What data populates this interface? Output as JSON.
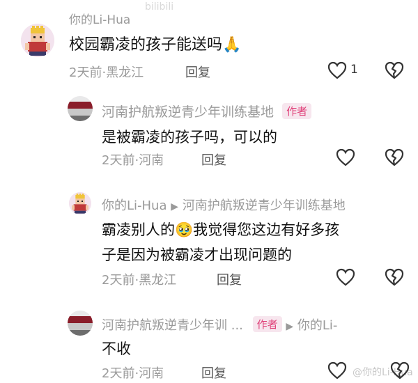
{
  "colors": {
    "accent": "#e0427a",
    "badge_bg": "#f7e6ee",
    "meta": "#9a9a9a",
    "text": "#111111"
  },
  "watermark": {
    "top": "bilibili",
    "bottom": "@你的Li-Hua"
  },
  "comments": [
    {
      "user": "你的Li-Hua",
      "text": "校园霸凌的孩子能送吗🙏",
      "time": "2天前",
      "location": "黑龙江",
      "reply": "回复",
      "likes": "1",
      "avatar_icon": "pixel-king-avatar-icon"
    },
    {
      "user": "河南护航叛逆青少年训练基地",
      "badge": "作者",
      "text": "是被霸凌的孩子吗，可以的",
      "time": "2天前",
      "location": "河南",
      "reply": "回复",
      "avatar_icon": "building-avatar-icon"
    },
    {
      "user": "你的Li-Hua",
      "reply_to": "河南护航叛逆青少年训练基地",
      "text_line1": "霸凌别人的🥹我觉得您这边有好多孩",
      "text_line2": "子是因为被霸凌才出现问题的",
      "time": "2天前",
      "location": "黑龙江",
      "reply": "回复",
      "avatar_icon": "pixel-king-avatar-icon"
    },
    {
      "user": "河南护航叛逆青少年训 ...",
      "badge": "作者",
      "reply_to": "你的Li-",
      "text": "不收",
      "time": "2天前",
      "location": "河南",
      "reply": "回复",
      "avatar_icon": "building-avatar-icon"
    }
  ],
  "separator": "·",
  "arrow": "▶"
}
